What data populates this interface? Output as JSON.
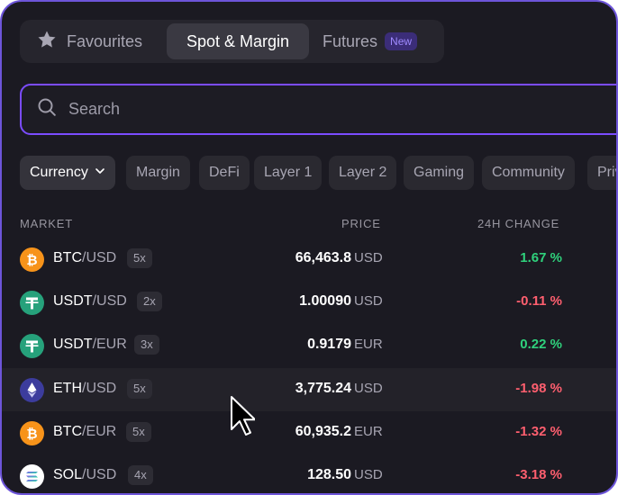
{
  "tabs": [
    {
      "label": "Favourites",
      "icon": "star-icon"
    },
    {
      "label": "Spot & Margin",
      "active": true
    },
    {
      "label": "Futures",
      "badge": "New"
    }
  ],
  "search": {
    "placeholder": "Search",
    "value": ""
  },
  "filters": [
    {
      "label": "Currency",
      "active": true,
      "icon": "chevron-down-icon"
    },
    {
      "label": "Margin"
    },
    {
      "label": "DeFi"
    },
    {
      "label": "Layer 1"
    },
    {
      "label": "Layer 2"
    },
    {
      "label": "Gaming"
    },
    {
      "label": "Community"
    },
    {
      "label": "Priv"
    }
  ],
  "table": {
    "headers": {
      "market": "MARKET",
      "price": "PRICE",
      "change": "24H CHANGE"
    },
    "rows": [
      {
        "base": "BTC",
        "quote": "/USD",
        "leverage": "5x",
        "price": "66,463.8",
        "currency": "USD",
        "change": "1.67 %",
        "direction": "up",
        "icon": "bitcoin-icon"
      },
      {
        "base": "USDT",
        "quote": "/USD",
        "leverage": "2x",
        "price": "1.00090",
        "currency": "USD",
        "change": "-0.11 %",
        "direction": "down",
        "icon": "tether-icon"
      },
      {
        "base": "USDT",
        "quote": "/EUR",
        "leverage": "3x",
        "price": "0.9179",
        "currency": "EUR",
        "change": "0.22 %",
        "direction": "up",
        "icon": "tether-icon"
      },
      {
        "base": "ETH",
        "quote": "/USD",
        "leverage": "5x",
        "price": "3,775.24",
        "currency": "USD",
        "change": "-1.98 %",
        "direction": "down",
        "icon": "ethereum-icon",
        "hovered": true
      },
      {
        "base": "BTC",
        "quote": "/EUR",
        "leverage": "5x",
        "price": "60,935.2",
        "currency": "EUR",
        "change": "-1.32 %",
        "direction": "down",
        "icon": "bitcoin-icon"
      },
      {
        "base": "SOL",
        "quote": "/USD",
        "leverage": "4x",
        "price": "128.50",
        "currency": "USD",
        "change": "-3.18 %",
        "direction": "down",
        "icon": "solana-icon"
      }
    ]
  },
  "colors": {
    "accent": "#7b4cff",
    "positive": "#2fd17c",
    "negative": "#ff5f6f",
    "bitcoin": "#f7931a",
    "tether": "#26a17b",
    "ethereum": "#3c3c9d"
  }
}
